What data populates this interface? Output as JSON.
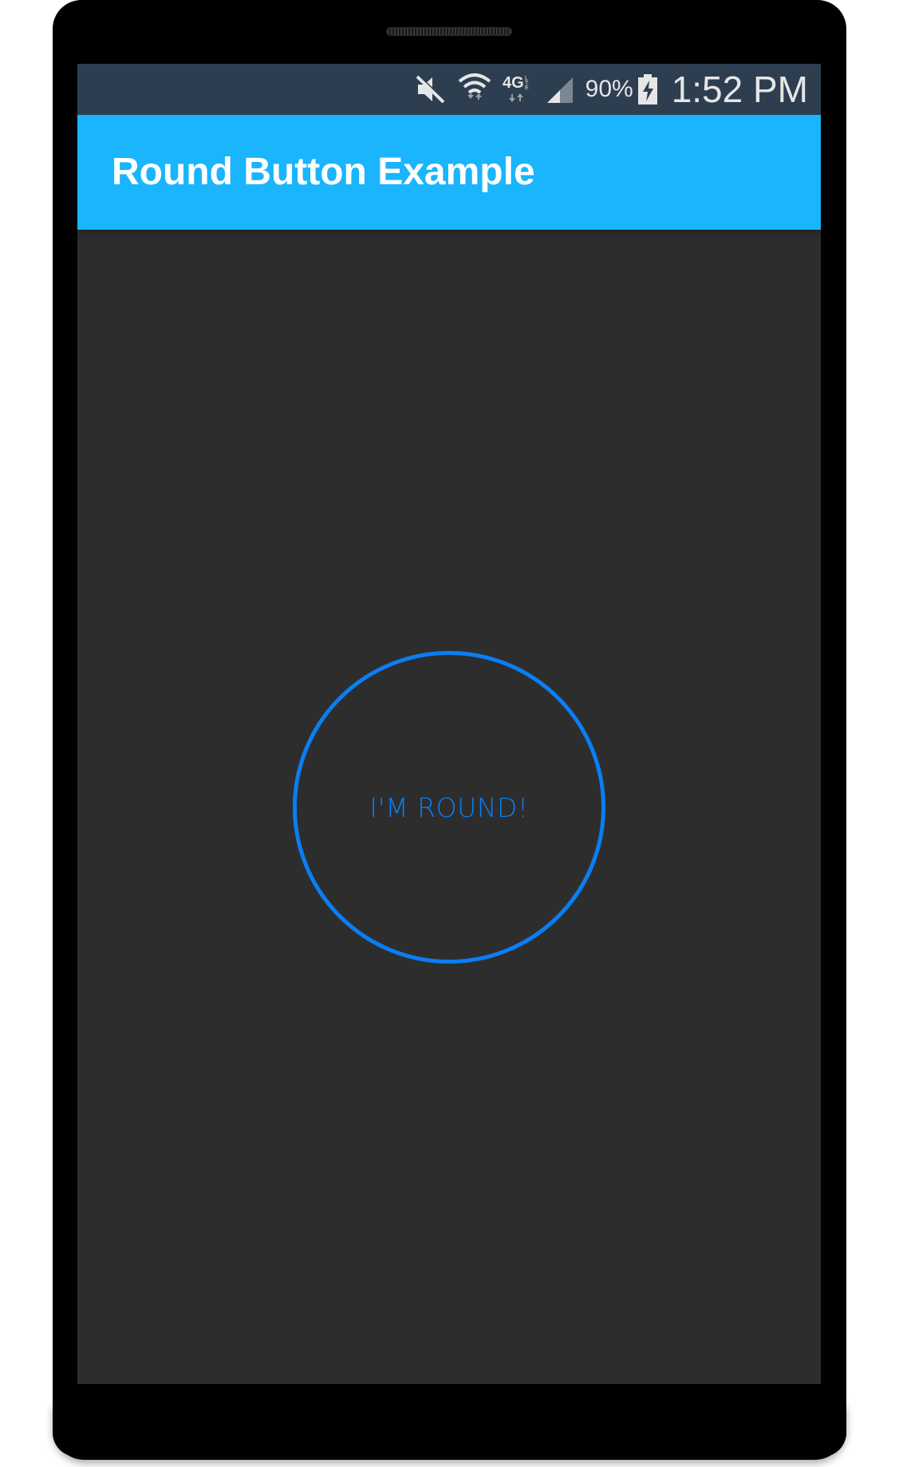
{
  "status_bar": {
    "icons": [
      "mute-icon",
      "wifi-icon",
      "4g-lte-icon",
      "signal-icon",
      "battery-charging-icon"
    ],
    "battery": "90%",
    "time": "1:52 PM"
  },
  "app_bar": {
    "title": "Round Button Example",
    "color": "#1ab5fc"
  },
  "main": {
    "round_button_label": "I'M ROUND!",
    "accent_color": "#0a7ef2",
    "background_color": "#2d2d2d"
  }
}
